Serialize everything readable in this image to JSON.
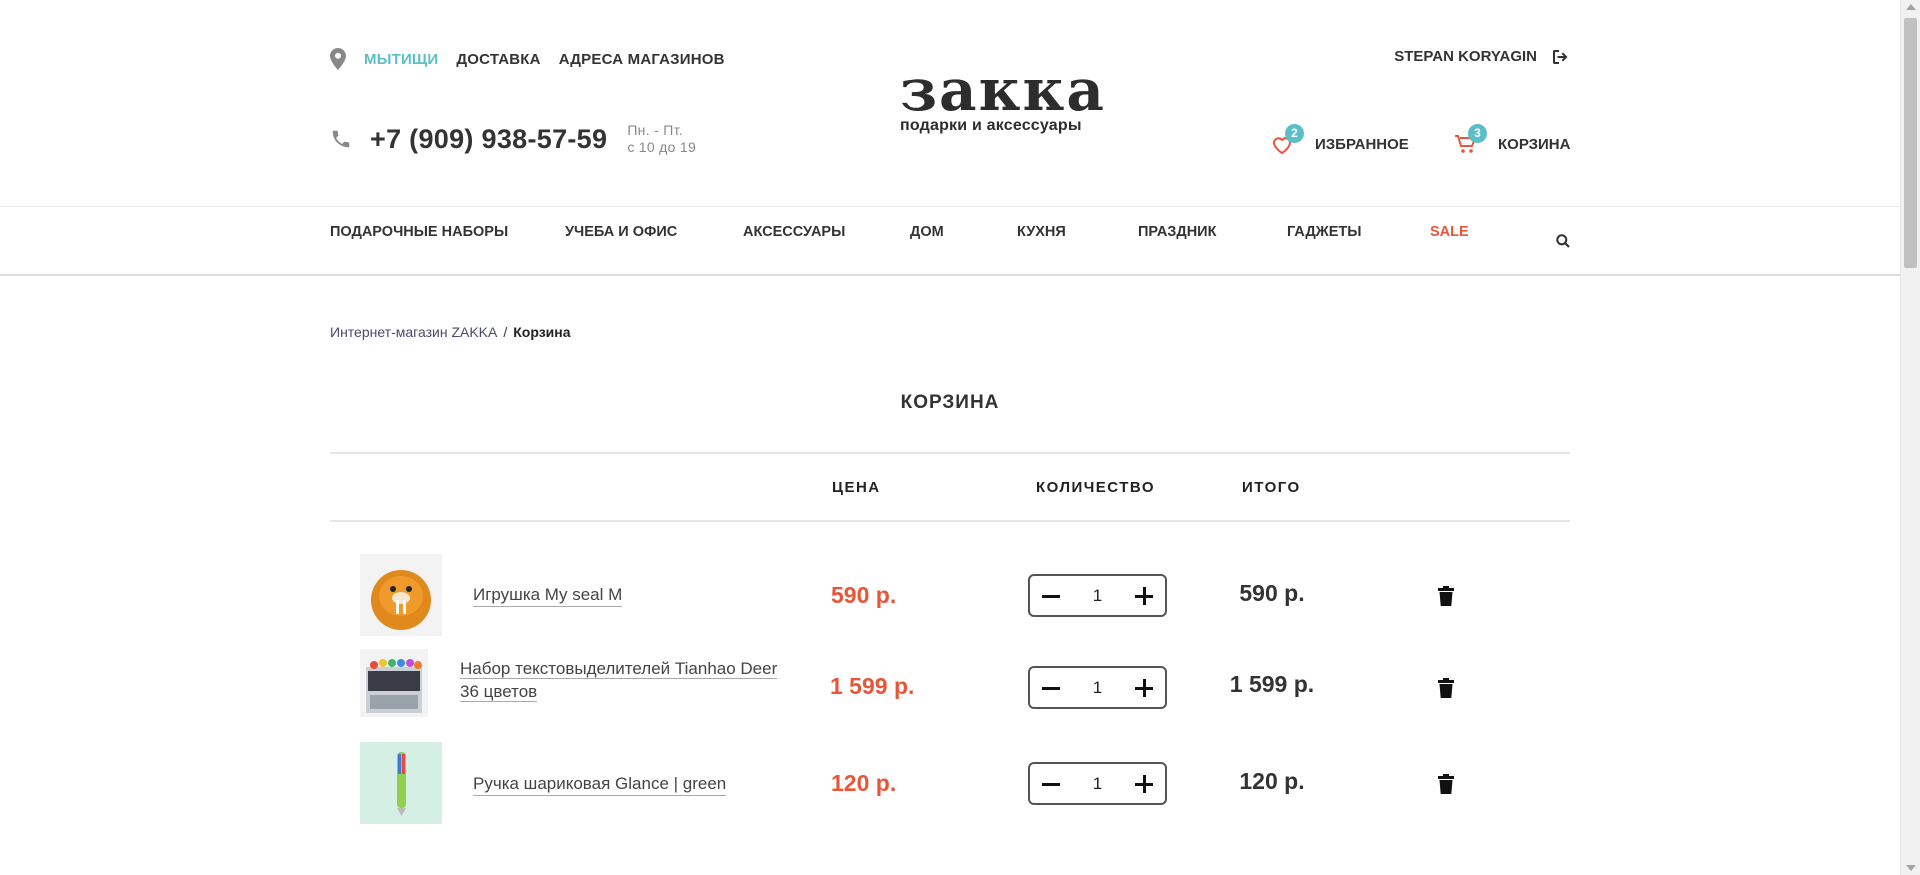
{
  "header": {
    "city": "МЫТИЩИ",
    "links": [
      "ДОСТАВКА",
      "АДРЕСА МАГАЗИНОВ"
    ],
    "phone": "+7 (909) 938-57-59",
    "hours_line1": "Пн. - Пт.",
    "hours_line2": "с 10 до 19",
    "logo_main": "закка",
    "logo_sub": "подарки и аксессуары",
    "user_name": "STEPAN KORYAGIN",
    "favorites_label": "ИЗБРАННОЕ",
    "favorites_count": "2",
    "cart_label": "КОРЗИНА",
    "cart_count": "3",
    "accent_color": "#5bbfc7",
    "sale_color": "#e8563a"
  },
  "nav": {
    "items": [
      "ПОДАРОЧНЫЕ НАБОРЫ",
      "УЧЕБА И ОФИС",
      "АКСЕССУАРЫ",
      "ДОМ",
      "КУХНЯ",
      "ПРАЗДНИК",
      "ГАДЖЕТЫ"
    ],
    "sale": "SALE",
    "search_icon": "search-icon"
  },
  "breadcrumb": {
    "home": "Интернет-магазин ZAKKA",
    "separator": "/",
    "current": "Корзина"
  },
  "page_title": "КОРЗИНА",
  "table": {
    "headers": {
      "price": "ЦЕНА",
      "quantity": "КОЛИЧЕСТВО",
      "total": "ИТОГО"
    },
    "rows": [
      {
        "name": "Игрушка My seal M",
        "price": "590 р.",
        "quantity": "1",
        "total": "590 р."
      },
      {
        "name_line1": "Набор текстовыделителей Tianhao Deer",
        "name_line2": "36 цветов",
        "price": "1 599 р.",
        "quantity": "1",
        "total": "1 599 р."
      },
      {
        "name": "Ручка шариковая Glance | green",
        "price": "120 р.",
        "quantity": "1",
        "total": "120 р."
      }
    ]
  }
}
